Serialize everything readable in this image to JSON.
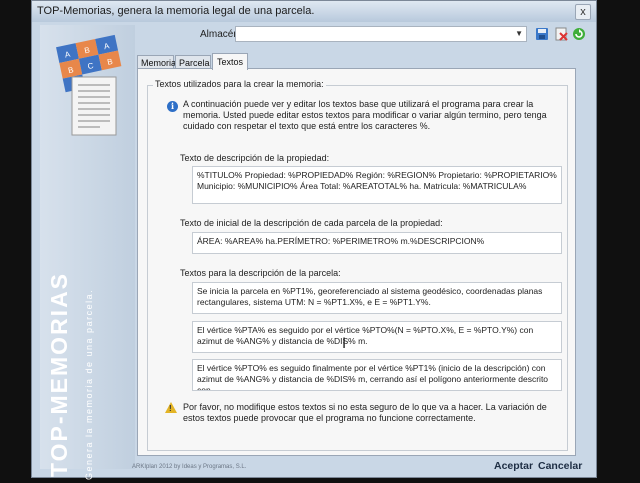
{
  "window": {
    "title": "TOP-Memorias, genera la memoria legal de una parcela.",
    "close_label": "x"
  },
  "sidebar": {
    "app_name": "TOP-MEMORIAS",
    "tagline": "Genera la memoria de una parcela.",
    "logo_letters": [
      "A",
      "B",
      "A",
      "B",
      "C",
      "B",
      "C"
    ]
  },
  "toolbar": {
    "almacen_label": "Almacén",
    "almacen_value": "",
    "icons": [
      "save-icon",
      "delete-icon",
      "refresh-icon"
    ]
  },
  "tabs": [
    {
      "label": "Memoria",
      "active": false
    },
    {
      "label": "Parcela",
      "active": false
    },
    {
      "label": "Textos",
      "active": true
    }
  ],
  "textos": {
    "group_title": "Textos utilizados para la crear la memoria:",
    "info_text": "A continuación puede ver y editar los textos base que utilizará el programa para crear la memoria. Usted puede editar estos textos para modificar o variar algún termino, pero tenga cuidado con respetar el texto que está entre los caracteres %.",
    "desc_propiedad_label": "Texto de descripción de la propiedad:",
    "desc_propiedad_value": "%TITULO% Propiedad: %PROPIEDAD% Región: %REGION% Propietario: %PROPIETARIO% Municipio: %MUNICIPIO% Área Total: %AREATOTAL% ha. Matricula: %MATRICULA%",
    "inicial_parcela_label": "Texto de inicial de la descripción de cada parcela de la propiedad:",
    "inicial_parcela_value": "ÁREA: %AREA% ha.PERÍMETRO: %PERIMETRO% m.%DESCRIPCION%",
    "desc_parcela_label": "Textos para la descripción de la parcela:",
    "desc_parcela_1": "Se inicia la parcela en %PT1%, georeferenciado al sistema geodésico, coordenadas planas rectangulares, sistema UTM: N = %PT1.X%, e E = %PT1.Y%.",
    "desc_parcela_2": "El vértice %PTA% es seguido por el vértice %PTO%(N = %PTO.X%, E = %PTO.Y%) con azimut de %ANG% y distancia de %DIS% m.",
    "desc_parcela_3": "El vértice %PTO% es seguido finalmente por el vértice %PT1% (inicio de la descripción) con azimut de %ANG% y distancia de %DIS% m, cerrando así el polígono anteriormente descrito con",
    "warning_text": "Por favor, no modifique estos textos si no esta seguro de lo que va a hacer. La variación de estos textos puede provocar que el programa no funcione correctamente."
  },
  "footer": {
    "copyright": "ARKIplan 2012 by Ideas y Programas, S.L.",
    "accept_label": "Aceptar",
    "cancel_label": "Cancelar"
  },
  "colors": {
    "logo_blue": "#3f74c4",
    "logo_orange": "#e8874a",
    "title_bar": "#c9d7e6"
  }
}
